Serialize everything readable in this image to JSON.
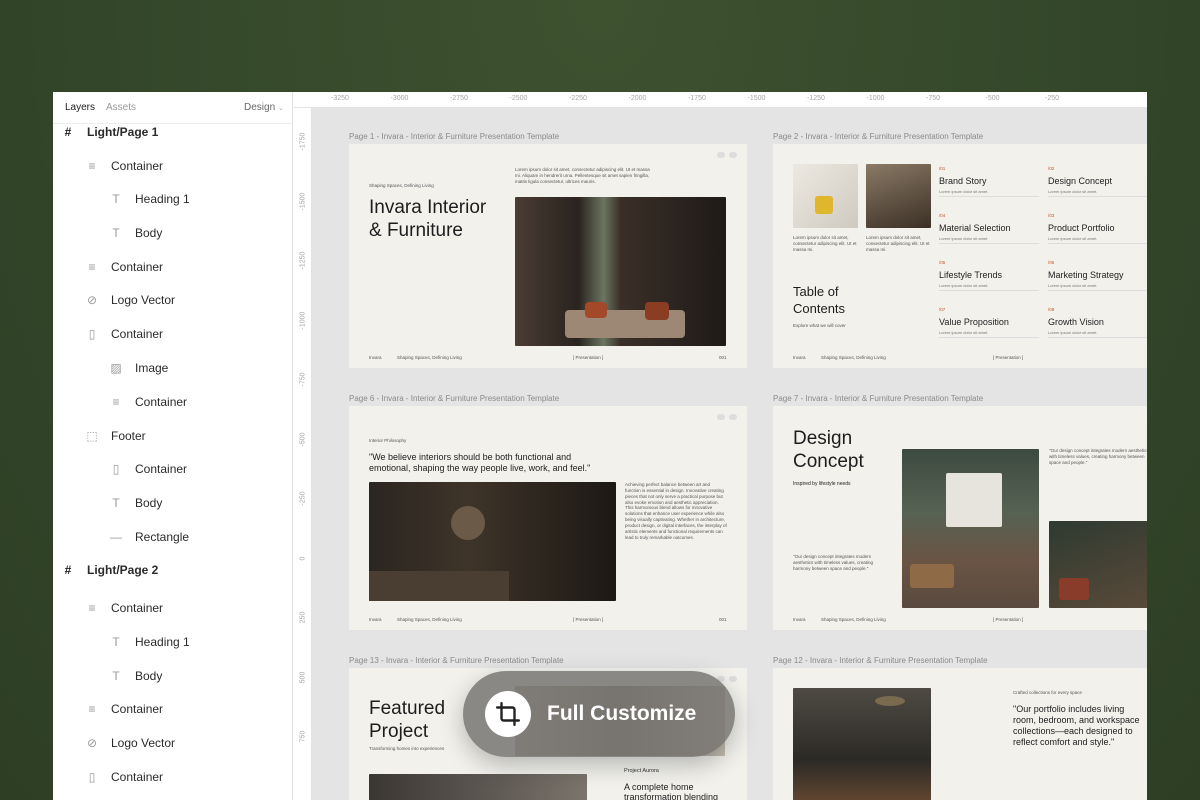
{
  "panel": {
    "tabs": [
      "Layers",
      "Assets"
    ],
    "mode": "Design",
    "layers": [
      {
        "label": "Light/Page 1",
        "icon": "frame-icon",
        "glyph": "#",
        "level": 0
      },
      {
        "label": "Container",
        "icon": "container-icon",
        "glyph": "≡",
        "level": 1
      },
      {
        "label": "Heading 1",
        "icon": "text-icon",
        "glyph": "T",
        "level": 2
      },
      {
        "label": "Body",
        "icon": "text-icon",
        "glyph": "T",
        "level": 2
      },
      {
        "label": "Container",
        "icon": "container-icon",
        "glyph": "≡",
        "level": 1
      },
      {
        "label": "Logo Vector",
        "icon": "vector-icon",
        "glyph": "⊘",
        "level": 1
      },
      {
        "label": "Container",
        "icon": "column-container-icon",
        "glyph": "▯",
        "level": 1
      },
      {
        "label": "Image",
        "icon": "image-icon",
        "glyph": "▨",
        "level": 2
      },
      {
        "label": "Container",
        "icon": "container-icon",
        "glyph": "≡",
        "level": 2
      },
      {
        "label": "Footer",
        "icon": "footer-icon",
        "glyph": "⬚",
        "level": 1
      },
      {
        "label": "Container",
        "icon": "column-container-icon",
        "glyph": "▯",
        "level": 2
      },
      {
        "label": "Body",
        "icon": "text-icon",
        "glyph": "T",
        "level": 2
      },
      {
        "label": "Rectangle",
        "icon": "rectangle-icon",
        "glyph": "—",
        "level": 2
      },
      {
        "label": "Light/Page 2",
        "icon": "frame-icon",
        "glyph": "#",
        "level": 0
      },
      {
        "label": "Container",
        "icon": "container-icon",
        "glyph": "≡",
        "level": 1
      },
      {
        "label": "Heading 1",
        "icon": "text-icon",
        "glyph": "T",
        "level": 2
      },
      {
        "label": "Body",
        "icon": "text-icon",
        "glyph": "T",
        "level": 2
      },
      {
        "label": "Container",
        "icon": "container-icon",
        "glyph": "≡",
        "level": 1
      },
      {
        "label": "Logo Vector",
        "icon": "vector-icon",
        "glyph": "⊘",
        "level": 1
      },
      {
        "label": "Container",
        "icon": "column-container-icon",
        "glyph": "▯",
        "level": 1
      }
    ]
  },
  "rulers": {
    "horizontal": [
      "-3250",
      "-3000",
      "-2750",
      "-2500",
      "-2250",
      "-2000",
      "-1750",
      "-1500",
      "-1250",
      "-1000",
      "-750",
      "-500",
      "-250"
    ],
    "vertical": [
      "-1750",
      "-1500",
      "-1250",
      "-1000",
      "-750",
      "-500",
      "-250",
      "0",
      "250",
      "500",
      "750"
    ]
  },
  "frames": {
    "p1": {
      "label": "Page 1 - Invara - Interior & Furniture Presentation Template",
      "tagline": "Shaping Spaces, Defining Living",
      "intro": "Lorem ipsum dolor sit amet, consectetur adipiscing elit. Ut et massa mi. Aliquam in hendrerit urna. Pellentesque sit amet sapien fringilla, mattis ligula consectetur, ultrices mauris.",
      "title_1": "Invara Interior",
      "title_2": "& Furniture",
      "footer_brand": "Invara",
      "footer_tag": "Shaping Spaces, Defining Living",
      "footer_mid": "[ Presentation ]",
      "footer_num": "001"
    },
    "p2": {
      "label": "Page 2 - Invara - Interior & Furniture Presentation Template",
      "caption": "Lorem ipsum dolor sit amet, consectetur adipiscing elit. Ut et massa mi.",
      "title_1": "Table of",
      "title_2": "Contents",
      "sub": "Explore what we will cover",
      "items": [
        {
          "num": "/01",
          "title": "Brand Story",
          "desc": "Lorem ipsum dolor sit amet."
        },
        {
          "num": "/02",
          "title": "Design Concept",
          "desc": "Lorem ipsum dolor sit amet."
        },
        {
          "num": "/04",
          "title": "Material Selection",
          "desc": "Lorem ipsum dolor sit amet."
        },
        {
          "num": "/03",
          "title": "Product Portfolio",
          "desc": "Lorem ipsum dolor sit amet."
        },
        {
          "num": "/05",
          "title": "Lifestyle Trends",
          "desc": "Lorem ipsum dolor sit amet."
        },
        {
          "num": "/06",
          "title": "Marketing Strategy",
          "desc": "Lorem ipsum dolor sit amet."
        },
        {
          "num": "/07",
          "title": "Value Proposition",
          "desc": "Lorem ipsum dolor sit amet."
        },
        {
          "num": "/08",
          "title": "Growth Vision",
          "desc": "Lorem ipsum dolor sit amet."
        }
      ],
      "footer_brand": "Invara",
      "footer_tag": "Shaping Spaces, Defining Living",
      "footer_mid": "[ Presentation ]"
    },
    "p6": {
      "label": "Page 6 - Invara - Interior & Furniture Presentation Template",
      "kicker": "Interior Philosophy",
      "quote_1": "\"We believe interiors should be both functional and",
      "quote_2": "emotional, shaping the way people live, work, and feel.\"",
      "body": "Achieving perfect balance between art and function is essential in design. Innovative creating pieces that not only serve a practical purpose but also evoke emotion and aesthetic appreciation. This harmonious blend allows for innovative solutions that enhance user experience while also being visually captivating. Whether in architecture, product design, or digital interfaces, the interplay of artistic elements and functional requirements can lead to truly remarkable outcomes.",
      "footer_brand": "Invara",
      "footer_tag": "Shaping Spaces, Defining Living",
      "footer_mid": "[ Presentation ]",
      "footer_num": "001"
    },
    "p7": {
      "label": "Page 7 - Invara - Interior & Furniture Presentation Template",
      "title_1": "Design",
      "title_2": "Concept",
      "sub": "Inspired by lifestyle needs",
      "quote": "\"Our design concept integrates modern aesthetics with timeless values, creating harmony between space and people.\"",
      "quote_right": "\"Our design concept integrates modern aesthetics with timeless values, creating harmony between space and people.\"",
      "footer_brand": "Invara",
      "footer_tag": "Shaping Spaces, Defining Living",
      "footer_mid": "[ Presentation ]"
    },
    "p13": {
      "label": "Page 13 - Invara - Interior & Furniture Presentation Template",
      "title_1": "Featured",
      "title_2": "Project",
      "sub": "Transforming homes into experiences",
      "project": "Project Aurora",
      "desc_1": "A complete home",
      "desc_2": "transformation blending"
    },
    "p12": {
      "label": "Page 12 - Invara - Interior & Furniture Presentation Template",
      "kicker": "Crafted collections for every space",
      "quote_1": "\"Our portfolio includes living",
      "quote_2": "room, bedroom, and workspace",
      "quote_3": "collections—each designed to",
      "quote_4": "reflect comfort and style.\""
    }
  },
  "overlay": {
    "label": "Full Customize",
    "icon": "crop-icon"
  }
}
